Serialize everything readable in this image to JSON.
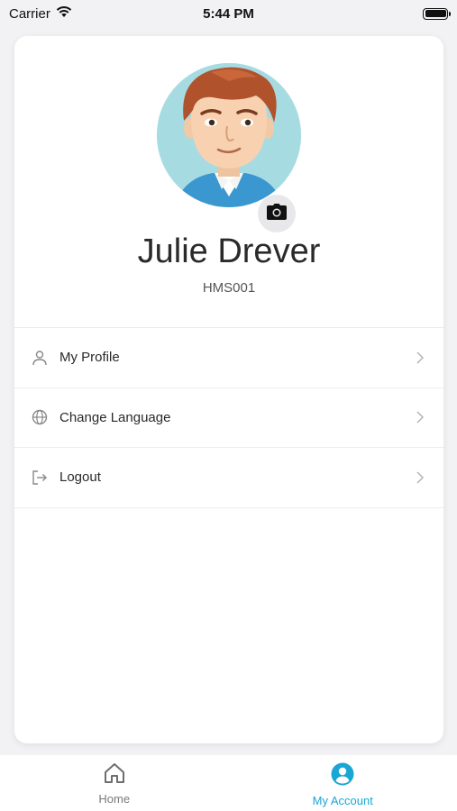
{
  "status_bar": {
    "carrier": "Carrier",
    "time": "5:44 PM"
  },
  "profile": {
    "name": "Julie Drever",
    "id": "HMS001"
  },
  "menu": {
    "items": [
      {
        "label": "My Profile",
        "icon": "person-icon"
      },
      {
        "label": "Change Language",
        "icon": "globe-icon"
      },
      {
        "label": "Logout",
        "icon": "logout-icon"
      }
    ]
  },
  "tabs": [
    {
      "label": "Home",
      "icon": "home-icon",
      "active": false
    },
    {
      "label": "My Account",
      "icon": "account-icon",
      "active": true
    }
  ],
  "colors": {
    "accent": "#1aa6d4",
    "avatar_bg": "#a7dbe2"
  }
}
